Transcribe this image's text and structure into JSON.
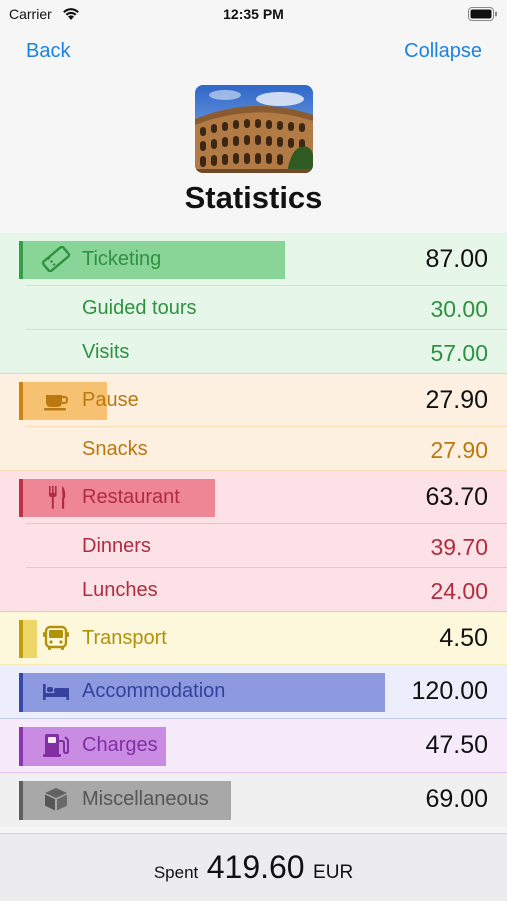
{
  "status_bar": {
    "carrier": "Carrier",
    "time": "12:35 PM"
  },
  "nav": {
    "back_label": "Back",
    "collapse_label": "Collapse"
  },
  "header": {
    "title": "Statistics",
    "image_icon": "colosseum-photo"
  },
  "categories": [
    {
      "name": "Ticketing",
      "value": "87.00",
      "icon": "ticket-icon",
      "color": "#3dba55",
      "bg": "#e6f7e9",
      "bar_fraction": 0.7241,
      "items": [
        {
          "name": "Guided tours",
          "value": "30.00"
        },
        {
          "name": "Visits",
          "value": "57.00"
        }
      ]
    },
    {
      "name": "Pause",
      "value": "27.90",
      "icon": "coffee-cup-icon",
      "color": "#f09a16",
      "bg": "#fdf0e1",
      "bar_fraction": 0.2323,
      "items": [
        {
          "name": "Snacks",
          "value": "27.90"
        }
      ]
    },
    {
      "name": "Restaurant",
      "value": "63.70",
      "icon": "fork-knife-icon",
      "color": "#e13a53",
      "bg": "#fce2e6",
      "bar_fraction": 0.5305,
      "items": [
        {
          "name": "Dinners",
          "value": "39.70"
        },
        {
          "name": "Lunches",
          "value": "24.00"
        }
      ]
    },
    {
      "name": "Transport",
      "value": "4.50",
      "icon": "bus-icon",
      "color": "#e3bb0a",
      "bg": "#fdf7dc",
      "bar_fraction": 0.0375,
      "items": []
    },
    {
      "name": "Accommodation",
      "value": "120.00",
      "icon": "bed-icon",
      "color": "#4255c8",
      "bg": "#eceefb",
      "bar_fraction": 1.0,
      "items": []
    },
    {
      "name": "Charges",
      "value": "47.50",
      "icon": "fuel-pump-icon",
      "color": "#a53ed0",
      "bg": "#f6eafb",
      "bar_fraction": 0.3956,
      "items": []
    },
    {
      "name": "Miscellaneous",
      "value": "69.00",
      "icon": "cube-icon",
      "color": "#6e6e6e",
      "bg": "#f0f0f1",
      "bar_fraction": 0.5746,
      "items": []
    }
  ],
  "footer": {
    "spent_label": "Spent",
    "total": "419.60",
    "currency": "EUR"
  }
}
